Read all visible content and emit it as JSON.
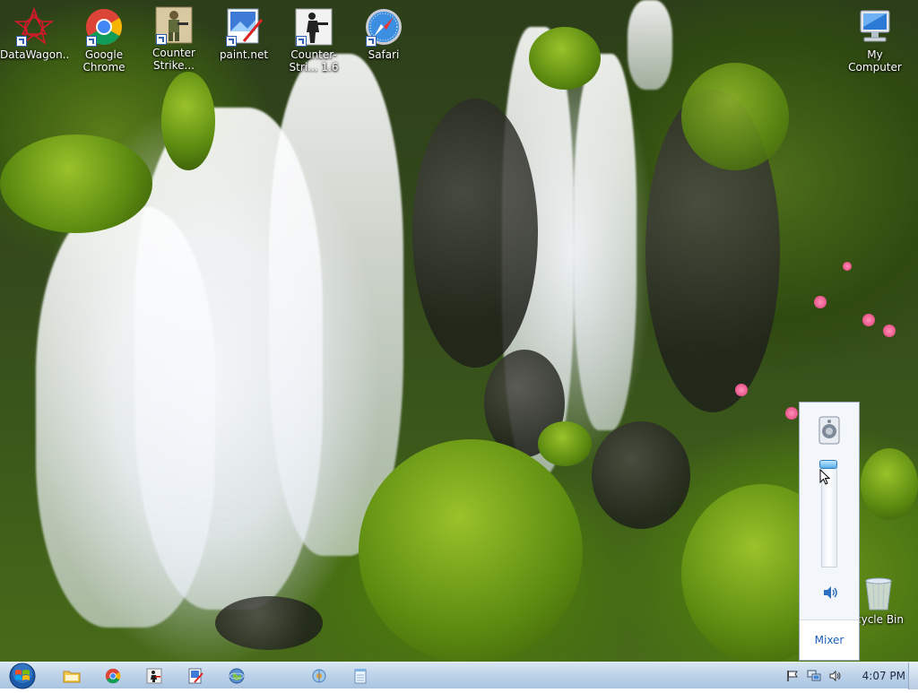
{
  "desktop": {
    "icons": [
      {
        "label": "DataWagon..."
      },
      {
        "label": "Google Chrome"
      },
      {
        "label": "Counter Strike..."
      },
      {
        "label": "paint.net"
      },
      {
        "label": "Counter-Stri... 1.6"
      },
      {
        "label": "Safari"
      },
      {
        "label": "My Computer"
      },
      {
        "label": "cycle Bin"
      }
    ]
  },
  "volume_flyout": {
    "mixer_label": "Mixer",
    "device_icon": "speaker-device-icon",
    "mute_icon": "speaker-icon"
  },
  "taskbar": {
    "pinned": [
      {
        "icon": "folder-icon"
      },
      {
        "icon": "chrome-icon"
      },
      {
        "icon": "counter-strike-icon"
      },
      {
        "icon": "paint-icon"
      },
      {
        "icon": "globe-icon"
      },
      {
        "icon": "network-app-icon"
      },
      {
        "icon": "notepad-icon"
      }
    ],
    "tray": {
      "clock": "4:07 PM",
      "icons": [
        "flag-icon",
        "network-icon",
        "volume-icon"
      ]
    }
  },
  "colors": {
    "accent": "#1c5fb8",
    "taskbar": "#bfd4ea"
  }
}
